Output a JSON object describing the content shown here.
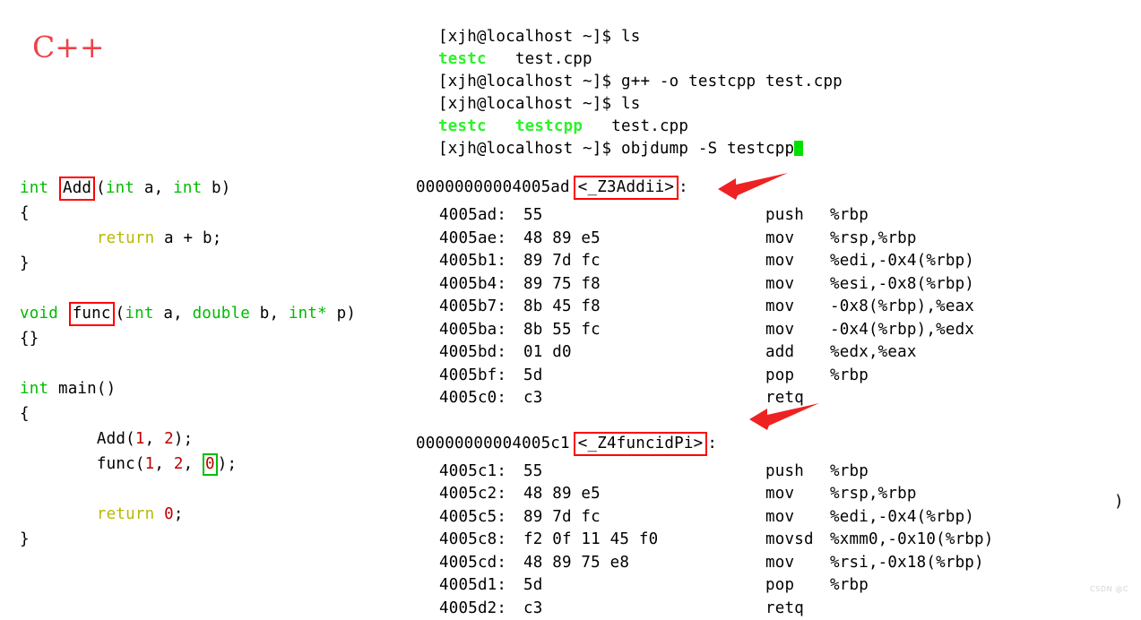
{
  "title": {
    "text": "C++",
    "color": "#f04048"
  },
  "colors": {
    "keyword_type": "#00bb00",
    "keyword_return": "#b8b800",
    "number": "#bb0000",
    "terminal_executable": "#2cf22c",
    "annotation_red": "#ff0000",
    "annotation_green": "#00c000",
    "cursor": "#00e000",
    "watermark": "#d4d4d4"
  },
  "source": {
    "lines": [
      {
        "segments": [
          {
            "text": "int ",
            "style": "kw"
          },
          {
            "text": "Add",
            "style": "boxed-red"
          },
          {
            "text": "(",
            "style": "plain"
          },
          {
            "text": "int",
            "style": "kw"
          },
          {
            "text": " a, ",
            "style": "plain"
          },
          {
            "text": "int",
            "style": "kw"
          },
          {
            "text": " b)",
            "style": "plain"
          }
        ]
      },
      {
        "segments": [
          {
            "text": "{",
            "style": "plain"
          }
        ]
      },
      {
        "segments": [
          {
            "text": "        ",
            "style": "plain"
          },
          {
            "text": "return",
            "style": "ret"
          },
          {
            "text": " a + b;",
            "style": "plain"
          }
        ]
      },
      {
        "segments": [
          {
            "text": "}",
            "style": "plain"
          }
        ]
      },
      {
        "segments": [
          {
            "text": "",
            "style": "plain"
          }
        ]
      },
      {
        "segments": [
          {
            "text": "void ",
            "style": "kw"
          },
          {
            "text": "func",
            "style": "boxed-red"
          },
          {
            "text": "(",
            "style": "plain"
          },
          {
            "text": "int",
            "style": "kw"
          },
          {
            "text": " a, ",
            "style": "plain"
          },
          {
            "text": "double",
            "style": "kw"
          },
          {
            "text": " b, ",
            "style": "plain"
          },
          {
            "text": "int*",
            "style": "kw"
          },
          {
            "text": " p)",
            "style": "plain"
          }
        ]
      },
      {
        "segments": [
          {
            "text": "{}",
            "style": "plain"
          }
        ]
      },
      {
        "segments": [
          {
            "text": "",
            "style": "plain"
          }
        ]
      },
      {
        "segments": [
          {
            "text": "int",
            "style": "kw"
          },
          {
            "text": " main()",
            "style": "plain"
          }
        ]
      },
      {
        "segments": [
          {
            "text": "{",
            "style": "plain"
          }
        ]
      },
      {
        "segments": [
          {
            "text": "        Add(",
            "style": "plain"
          },
          {
            "text": "1",
            "style": "num"
          },
          {
            "text": ", ",
            "style": "plain"
          },
          {
            "text": "2",
            "style": "num"
          },
          {
            "text": ");",
            "style": "plain"
          }
        ]
      },
      {
        "segments": [
          {
            "text": "        func(",
            "style": "plain"
          },
          {
            "text": "1",
            "style": "num"
          },
          {
            "text": ", ",
            "style": "plain"
          },
          {
            "text": "2",
            "style": "num"
          },
          {
            "text": ", ",
            "style": "plain"
          },
          {
            "text": "0",
            "style": "boxed-green"
          },
          {
            "text": ");",
            "style": "plain"
          }
        ]
      },
      {
        "segments": [
          {
            "text": "",
            "style": "plain"
          }
        ]
      },
      {
        "segments": [
          {
            "text": "        ",
            "style": "plain"
          },
          {
            "text": "return",
            "style": "ret"
          },
          {
            "text": " ",
            "style": "plain"
          },
          {
            "text": "0",
            "style": "num"
          },
          {
            "text": ";",
            "style": "plain"
          }
        ]
      },
      {
        "segments": [
          {
            "text": "}",
            "style": "plain"
          }
        ]
      }
    ]
  },
  "terminal": {
    "prompt": "[xjh@localhost ~]$ ",
    "lines": [
      {
        "type": "prompt",
        "command": "ls"
      },
      {
        "type": "output",
        "segments": [
          {
            "text": "testc",
            "style": "dir"
          },
          {
            "text": "   test.cpp",
            "style": "plain"
          }
        ]
      },
      {
        "type": "prompt",
        "command": "g++ -o testcpp test.cpp"
      },
      {
        "type": "prompt",
        "command": "ls"
      },
      {
        "type": "output",
        "segments": [
          {
            "text": "testc",
            "style": "dir"
          },
          {
            "text": "   ",
            "style": "plain"
          },
          {
            "text": "testcpp",
            "style": "dir"
          },
          {
            "text": "   test.cpp",
            "style": "plain"
          }
        ]
      },
      {
        "type": "prompt",
        "command": "objdump -S testcpp",
        "cursor": true
      }
    ],
    "clipped_line": "[xjh@localhost ~]$ objdump -S testcpp"
  },
  "objdump": {
    "blocks": [
      {
        "header_address": "00000000004005ad",
        "header_symbol": "<_Z3Addii>",
        "header_colon": ":",
        "rows": [
          {
            "address": "4005ad:",
            "bytes": "55",
            "mnemonic": "push",
            "operands": "%rbp"
          },
          {
            "address": "4005ae:",
            "bytes": "48 89 e5",
            "mnemonic": "mov",
            "operands": "%rsp,%rbp"
          },
          {
            "address": "4005b1:",
            "bytes": "89 7d fc",
            "mnemonic": "mov",
            "operands": "%edi,-0x4(%rbp)"
          },
          {
            "address": "4005b4:",
            "bytes": "89 75 f8",
            "mnemonic": "mov",
            "operands": "%esi,-0x8(%rbp)"
          },
          {
            "address": "4005b7:",
            "bytes": "8b 45 f8",
            "mnemonic": "mov",
            "operands": "-0x8(%rbp),%eax"
          },
          {
            "address": "4005ba:",
            "bytes": "8b 55 fc",
            "mnemonic": "mov",
            "operands": "-0x4(%rbp),%edx"
          },
          {
            "address": "4005bd:",
            "bytes": "01 d0",
            "mnemonic": "add",
            "operands": "%edx,%eax"
          },
          {
            "address": "4005bf:",
            "bytes": "5d",
            "mnemonic": "pop",
            "operands": "%rbp"
          },
          {
            "address": "4005c0:",
            "bytes": "c3",
            "mnemonic": "retq",
            "operands": ""
          }
        ]
      },
      {
        "header_address": "00000000004005c1",
        "header_symbol": "<_Z4funcidPi>",
        "header_colon": ":",
        "rows": [
          {
            "address": "4005c1:",
            "bytes": "55",
            "mnemonic": "push",
            "operands": "%rbp"
          },
          {
            "address": "4005c2:",
            "bytes": "48 89 e5",
            "mnemonic": "mov",
            "operands": "%rsp,%rbp"
          },
          {
            "address": "4005c5:",
            "bytes": "89 7d fc",
            "mnemonic": "mov",
            "operands": "%edi,-0x4(%rbp)"
          },
          {
            "address": "4005c8:",
            "bytes": "f2 0f 11 45 f0",
            "mnemonic": "movsd",
            "operands": "%xmm0,-0x10(%rbp)"
          },
          {
            "address": "4005cd:",
            "bytes": "48 89 75 e8",
            "mnemonic": "mov",
            "operands": "%rsi,-0x18(%rbp)"
          },
          {
            "address": "4005d1:",
            "bytes": "5d",
            "mnemonic": "pop",
            "operands": "%rbp"
          },
          {
            "address": "4005d2:",
            "bytes": "c3",
            "mnemonic": "retq",
            "operands": ""
          }
        ]
      }
    ],
    "stray_glyph": ")"
  },
  "annotations": {
    "arrows": [
      {
        "name": "arrow-to-z3addii",
        "target": "<_Z3Addii>"
      },
      {
        "name": "arrow-to-z4funcidpi",
        "target": "<_Z4funcidPi>"
      }
    ]
  },
  "watermark": {
    "text": "CSDN @C"
  }
}
